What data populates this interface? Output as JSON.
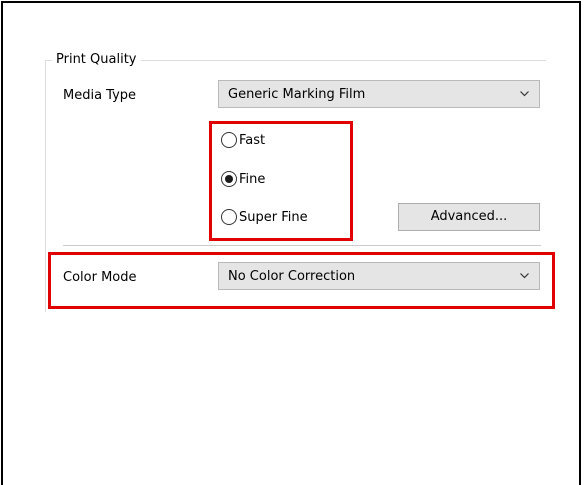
{
  "print_quality": {
    "group_title": "Print Quality",
    "media_type_label": "Media Type",
    "media_type_value": "Generic Marking Film",
    "quality_options": [
      {
        "label": "Fast",
        "selected": false
      },
      {
        "label": "Fine",
        "selected": true
      },
      {
        "label": "Super Fine",
        "selected": false
      }
    ],
    "advanced_button_label": "Advanced...",
    "color_mode_label": "Color Mode",
    "color_mode_value": "No Color Correction"
  },
  "icons": {
    "dropdown_arrow": "chevron-down-icon"
  },
  "colors": {
    "highlight": "#e00000",
    "control_background": "#e5e5e5",
    "selected_radio": "#1b1b1b"
  }
}
